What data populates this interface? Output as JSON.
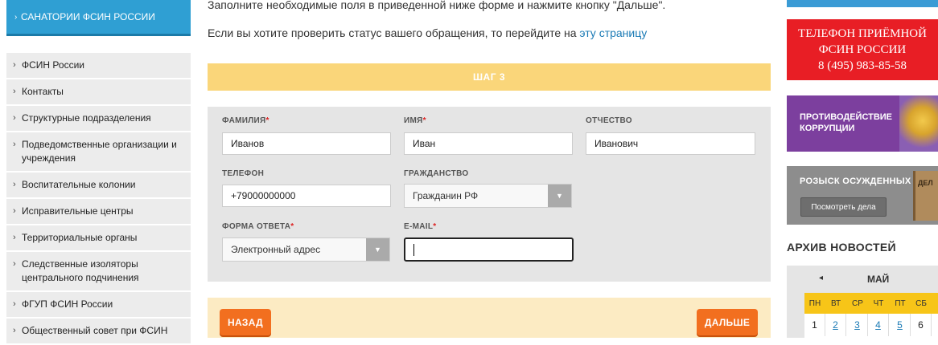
{
  "sidebar": {
    "top_button": "САНАТОРИИ ФСИН РОССИИ",
    "items": [
      {
        "label": "ФСИН России"
      },
      {
        "label": "Контакты"
      },
      {
        "label": "Структурные подразделения"
      },
      {
        "label": "Подведомственные организации и учреждения"
      },
      {
        "label": "Воспитательные колонии"
      },
      {
        "label": "Исправительные центры"
      },
      {
        "label": "Территориальные органы"
      },
      {
        "label": "Следственные изоляторы центрального подчинения"
      },
      {
        "label": "ФГУП ФСИН России"
      },
      {
        "label": "Общественный совет при ФСИН"
      }
    ]
  },
  "main": {
    "intro_line1": "Заполните необходимые поля в приведенной ниже форме и нажмите кнопку \"Дальше\".",
    "intro_line2": "Если вы хотите проверить статус вашего обращения, то перейдите на",
    "intro_link": "эту страницу",
    "step_label": "ШАГ 3",
    "form": {
      "surname_label": "ФАМИЛИЯ",
      "surname_value": "Иванов",
      "name_label": "ИМЯ",
      "name_value": "Иван",
      "patronymic_label": "ОТЧЕСТВО",
      "patronymic_value": "Иванович",
      "phone_label": "ТЕЛЕФОН",
      "phone_value": "+79000000000",
      "citizenship_label": "ГРАЖДАНСТВО",
      "citizenship_value": "Гражданин РФ",
      "response_form_label": "ФОРМА ОТВЕТА",
      "response_form_value": "Электронный адрес",
      "email_label": "E-MAIL",
      "email_value": "",
      "required_mark": "*"
    },
    "back_button": "НАЗАД",
    "next_button": "ДАЛЬШЕ"
  },
  "right": {
    "phone_banner_line1": "ТЕЛЕФОН ПРИЁМНОЙ",
    "phone_banner_line2": "ФСИН РОССИИ",
    "phone_banner_number": "8 (495) 983-85-58",
    "corruption_line1": "ПРОТИВОДЕЙСТВИЕ",
    "corruption_line2": "КОРРУПЦИИ",
    "wanted_title": "РОЗЫСК ОСУЖДЕННЫХ",
    "wanted_button": "Посмотреть дела",
    "wanted_image_text": "ДЕЛ",
    "archive_title": "АРХИВ НОВОСТЕЙ",
    "calendar": {
      "prev_icon": "◂",
      "month": "МАЙ",
      "weekdays": [
        "ПН",
        "ВТ",
        "СР",
        "ЧТ",
        "ПТ",
        "СБ"
      ],
      "dates": [
        "1",
        "2",
        "3",
        "4",
        "5",
        "6"
      ]
    }
  },
  "colors": {
    "sidebar_active": "#2f9fd3",
    "step_bar": "#fad67a",
    "orange_button": "#f26f1f",
    "phone_banner": "#e81e25",
    "corruption_banner": "#7c3f9e",
    "calendar_weekdays": "#f7c518"
  }
}
